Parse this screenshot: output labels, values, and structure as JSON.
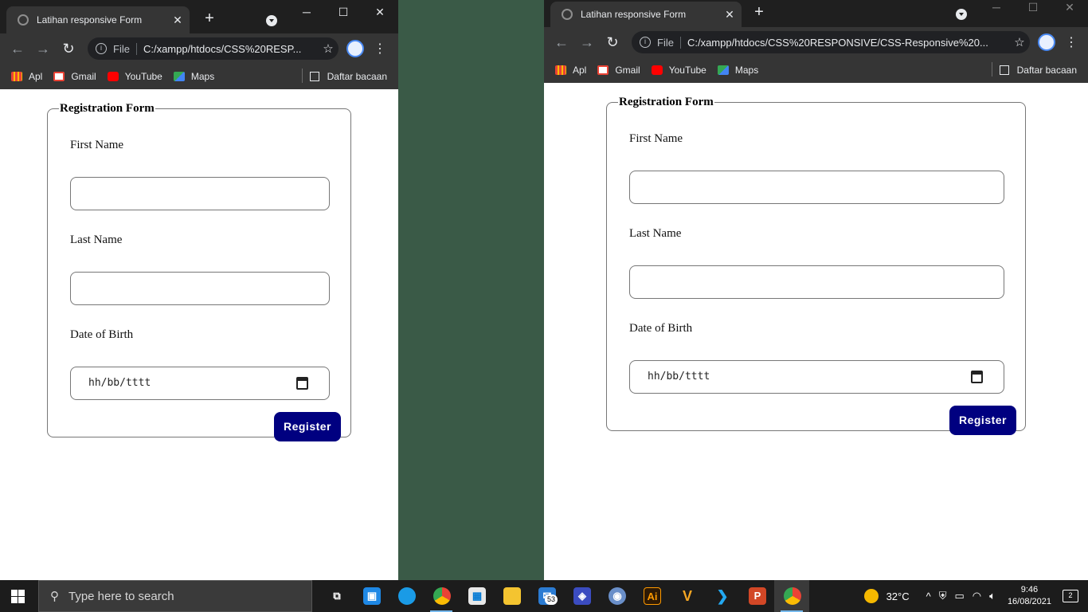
{
  "left_window": {
    "tab_title": "Latihan responsive Form",
    "url_scheme": "File",
    "url": "C:/xampp/htdocs/CSS%20RESP...",
    "bookmarks": [
      "Apl",
      "Gmail",
      "YouTube",
      "Maps"
    ],
    "reading_list": "Daftar bacaan"
  },
  "right_window": {
    "tab_title": "Latihan responsive Form",
    "url_scheme": "File",
    "url": "C:/xampp/htdocs/CSS%20RESPONSIVE/CSS-Responsive%20...",
    "bookmarks": [
      "Apl",
      "Gmail",
      "YouTube",
      "Maps"
    ],
    "reading_list": "Daftar bacaan"
  },
  "form": {
    "legend": "Registration Form",
    "first_name_label": "First Name",
    "last_name_label": "Last Name",
    "dob_label": "Date of Birth",
    "dob_placeholder": "hh/bb/tttt",
    "register_label": "Register"
  },
  "taskbar": {
    "search_placeholder": "Type here to search",
    "mail_badge": "53",
    "illustrator_label": "Ai",
    "v_label": "V",
    "ppt_label": "P",
    "weather": "32°C",
    "time": "9:46",
    "date": "16/08/2021",
    "notifications": "2"
  },
  "colors": {
    "register_button": "#000080",
    "desktop": "#3a5a47",
    "chrome_dark": "#353535"
  }
}
